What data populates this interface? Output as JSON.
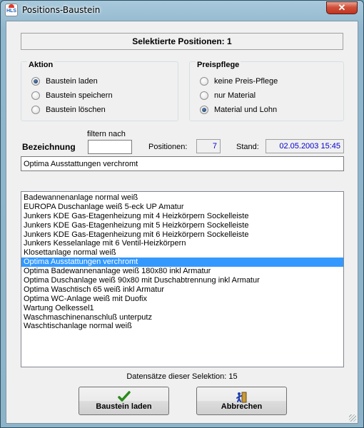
{
  "window": {
    "title": "Positions-Baustein",
    "close_label": "✕",
    "logo_text": "HLS"
  },
  "header": {
    "selected_positions": "Selektierte Positionen: 1"
  },
  "aktion": {
    "title": "Aktion",
    "options": [
      {
        "label": "Baustein laden",
        "checked": true
      },
      {
        "label": "Baustein speichern",
        "checked": false
      },
      {
        "label": "Baustein löschen",
        "checked": false
      }
    ]
  },
  "preispflege": {
    "title": "Preispflege",
    "options": [
      {
        "label": "keine Preis-Pflege",
        "checked": false
      },
      {
        "label": "nur Material",
        "checked": false
      },
      {
        "label": "Material und Lohn",
        "checked": true
      }
    ]
  },
  "filter": {
    "bezeichnung_label": "Bezeichnung",
    "filter_label": "filtern nach",
    "filter_value": "",
    "positionen_label": "Positionen:",
    "positionen_value": "7",
    "stand_label": "Stand:",
    "stand_value": "02.05.2003 15:45"
  },
  "selected_name": "Optima Ausstattungen verchromt",
  "list": {
    "items": [
      "Badewannenanlage normal weiß",
      "EUROPA Duschanlage weiß 5-eck UP Amatur",
      "Junkers KDE Gas-Etagenheizung  mit 4 Heizkörpern Sockelleiste",
      "Junkers KDE Gas-Etagenheizung  mit 5 Heizkörpern Sockelleiste",
      "Junkers KDE Gas-Etagenheizung  mit 6 Heizkörpern Sockelleiste",
      "Junkers Kesselanlage mit 6 Ventil-Heizkörpern",
      "Klosettanlage normal weiß",
      "Optima Ausstattungen verchromt",
      "Optima Badewannenanlage weiß 180x80  inkl Armatur",
      "Optima Duschanlage weiß 90x80 mit Duschabtrennung inkl Armatur",
      "Optima Waschtisch 65 weiß inkl Armatur",
      "Optima WC-Anlage weiß mit Duofix",
      "Wartung Oelkessel1",
      "Waschmaschinenanschluß unterputz",
      "Waschtischanlage normal weiß"
    ],
    "selected_index": 7
  },
  "status": {
    "records": "Datensätze dieser Selektion: 15"
  },
  "buttons": {
    "load": {
      "label": "Baustein laden",
      "icon": "checkmark-icon"
    },
    "cancel": {
      "label": "Abbrechen",
      "icon": "exit-door-icon"
    }
  },
  "colors": {
    "selection": "#3399ff",
    "stand_text": "#0000cc",
    "positions_text": "#0000cc"
  }
}
